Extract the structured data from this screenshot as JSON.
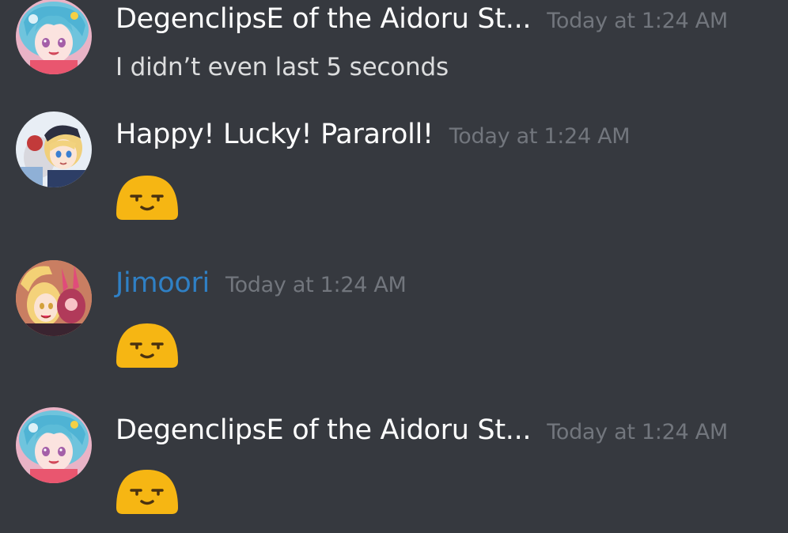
{
  "messages": [
    {
      "author": "DegenclipsE of the Aidoru St...",
      "timestamp": "Today at 1:24 AM",
      "author_color": "#ffffff",
      "content": "I didn’t even last 5 seconds",
      "avatar_icon": "blue-hair-anime-avatar"
    },
    {
      "author": "Happy! Lucky! Pararoll!",
      "timestamp": "Today at 1:24 AM",
      "author_color": "#ffffff",
      "content_emoji": "unamused-blob-emoji",
      "avatar_icon": "blonde-anime-avatar"
    },
    {
      "author": "Jimoori",
      "timestamp": "Today at 1:24 AM",
      "author_color": "#2f80c5",
      "content_emoji": "unamused-blob-emoji",
      "avatar_icon": "pink-anime-avatar"
    },
    {
      "author": "DegenclipsE of the Aidoru St...",
      "timestamp": "Today at 1:24 AM",
      "author_color": "#ffffff",
      "content_emoji": "unamused-blob-emoji",
      "avatar_icon": "blue-hair-anime-avatar"
    }
  ],
  "colors": {
    "background": "#36393f",
    "timestamp": "#72767d",
    "emoji_yellow": "#f6b613"
  }
}
